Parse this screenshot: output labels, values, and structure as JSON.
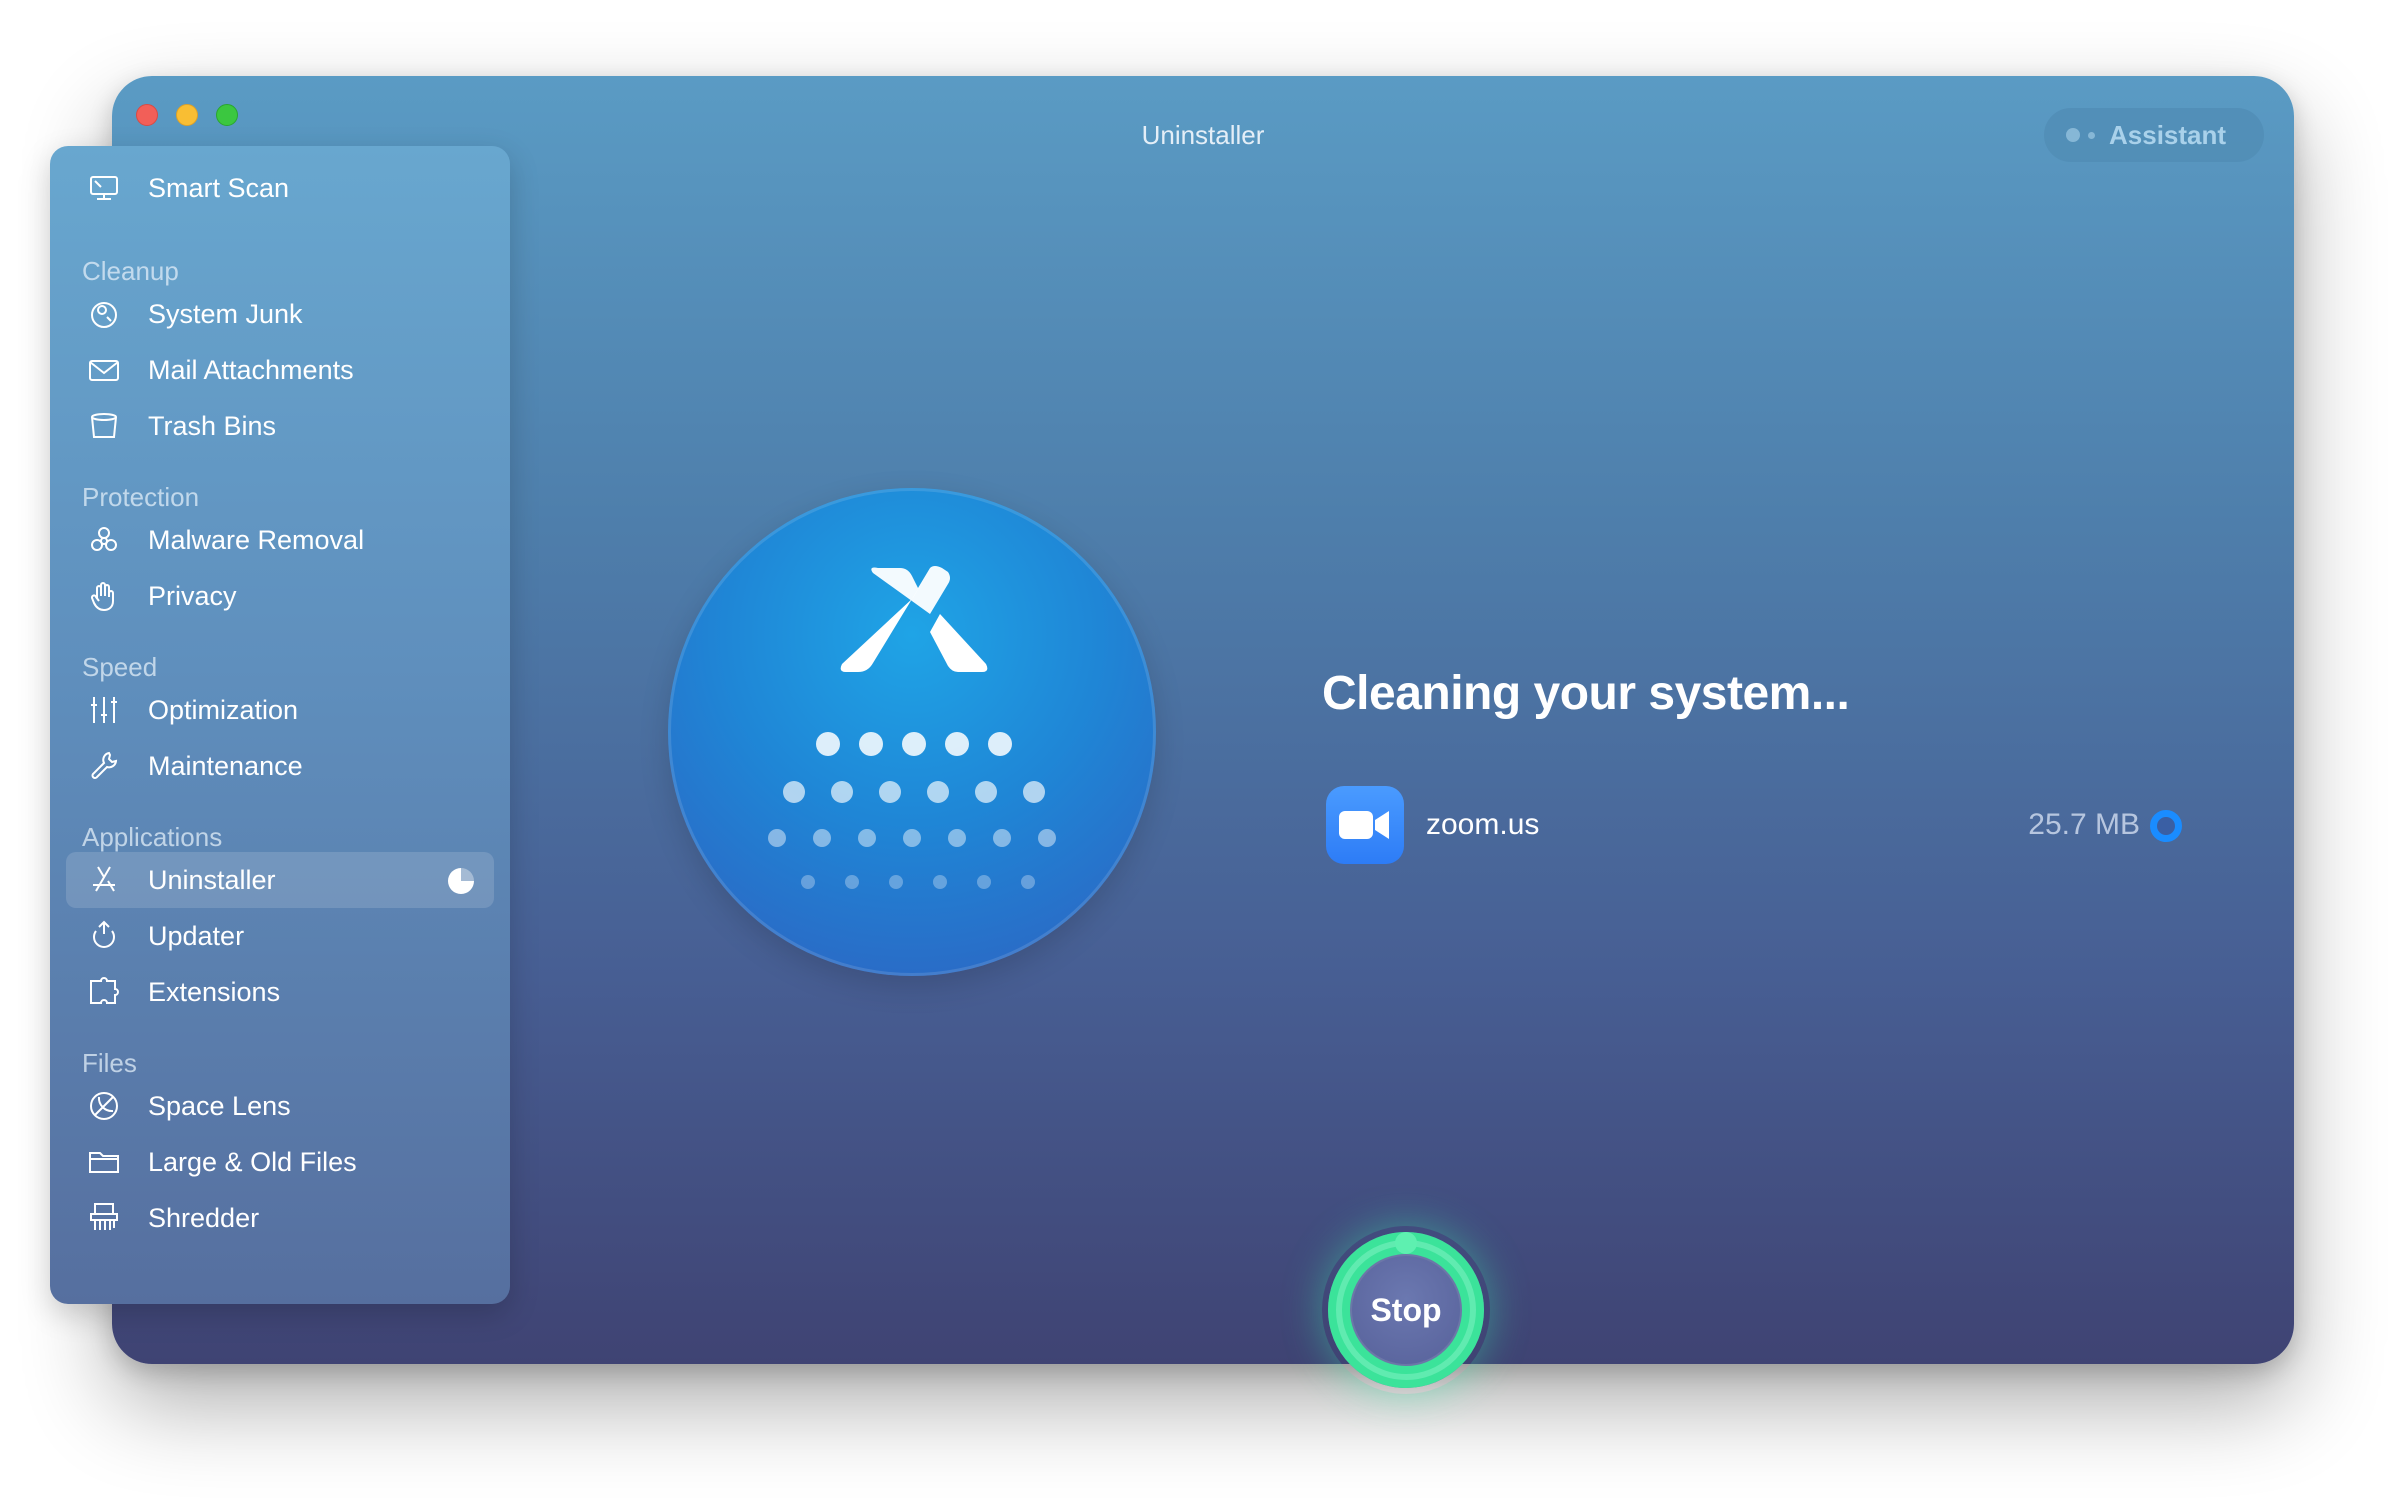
{
  "window": {
    "title": "Uninstaller"
  },
  "assistant": {
    "label": "Assistant"
  },
  "sidebar": {
    "smart_scan": "Smart Scan",
    "sections": {
      "cleanup": "Cleanup",
      "protection": "Protection",
      "speed": "Speed",
      "applications": "Applications",
      "files": "Files"
    },
    "items": {
      "system_junk": "System Junk",
      "mail_attachments": "Mail Attachments",
      "trash_bins": "Trash Bins",
      "malware_removal": "Malware Removal",
      "privacy": "Privacy",
      "optimization": "Optimization",
      "maintenance": "Maintenance",
      "uninstaller": "Uninstaller",
      "updater": "Updater",
      "extensions": "Extensions",
      "space_lens": "Space Lens",
      "large_old_files": "Large & Old Files",
      "shredder": "Shredder"
    },
    "active": "Uninstaller"
  },
  "main": {
    "heading": "Cleaning your system...",
    "items": [
      {
        "name": "zoom.us",
        "size": "25.7 MB",
        "icon": "video-camera-icon"
      }
    ],
    "stop_label": "Stop"
  },
  "colors": {
    "progress_ring": "#3be39a",
    "accent_blue": "#1a8cff",
    "close": "#f25f58",
    "minimize": "#f9be33",
    "zoom": "#3bc740"
  }
}
